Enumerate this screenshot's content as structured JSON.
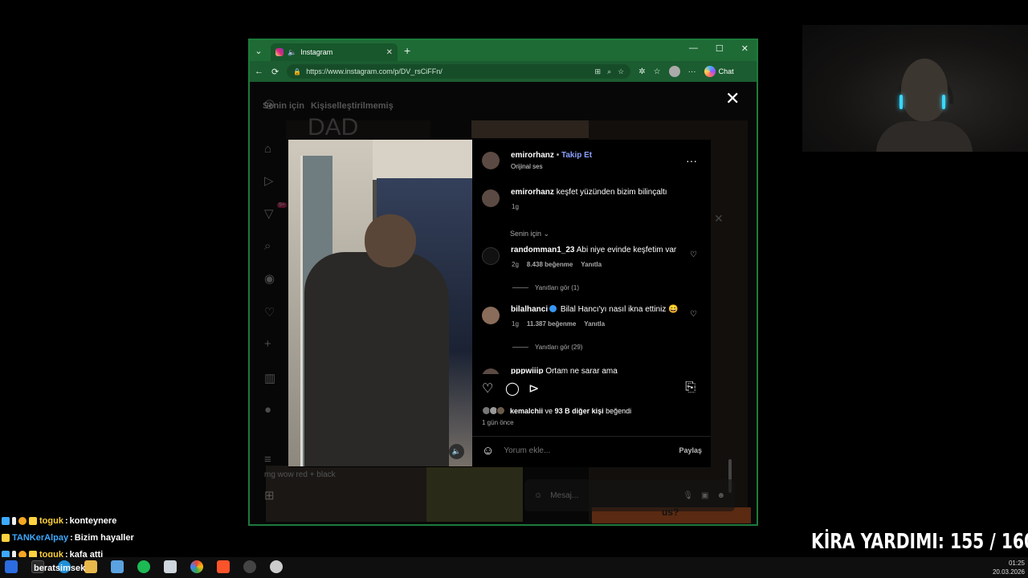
{
  "browser": {
    "tab_title": "Instagram",
    "url": "https://www.instagram.com/p/DV_rsCiFFn/",
    "chat_label": "Chat",
    "accent_color": "#1f6b36"
  },
  "feed": {
    "tab_for_you": "Senin için",
    "tab_unpersonalized": "Kişiselleştirilmemiş",
    "bg_text_dad": "DAD",
    "bg_caption": "mg wow red + black",
    "bg_text_us": "us?",
    "notif_badge": "9+",
    "message_placeholder": "Mesaj..."
  },
  "post": {
    "username": "emirorhanz",
    "separator": "•",
    "follow_label": "Takip Et",
    "audio": "Orijinal ses",
    "caption_user": "emirorhanz",
    "caption_text": "keşfet yüzünden bizim bilinçaltı",
    "caption_age": "1g",
    "sort_label": "Senin için",
    "comments": [
      {
        "user": "randomman1_23",
        "text": "Abi niye evinde keşfetim var",
        "age": "2g",
        "likes": "8.438 beğenme",
        "reply": "Yanıtla",
        "replies": "Yanıtları gör (1)"
      },
      {
        "user": "bilalhanci",
        "text": "Bilal Hancı'yı nasıl ikna ettiniz 😄",
        "age": "1g",
        "likes": "11.387 beğenme",
        "reply": "Yanıtla",
        "replies": "Yanıtları gör (29)"
      },
      {
        "user": "pppwiiip",
        "text": "Ortam ne sarar ama"
      }
    ],
    "liked_by_user": "kemalchii",
    "liked_by_rest": "ve",
    "liked_by_count": "93 B diğer kişi",
    "liked_by_suffix": "beğendi",
    "posted_ago": "1 gün önce",
    "comment_placeholder": "Yorum ekle...",
    "share_label": "Paylaş"
  },
  "chat": [
    {
      "name": "toguk",
      "sep": ":",
      "msg": "konteynere",
      "name_color": "#ffd23f"
    },
    {
      "name": "TANKerAlpay",
      "sep": ":",
      "msg": "Bizim hayaller",
      "name_color": "#3da9ff"
    },
    {
      "name": "toguk",
      "sep": ":",
      "msg": "kafa atti",
      "name_color": "#ffd23f"
    }
  ],
  "overlay": {
    "kira": "KİRA YARDIMI:  155 / 160"
  },
  "taskbar": {
    "user_label": "beratsimsek",
    "time": "01:25",
    "date": "20.03.2026"
  }
}
